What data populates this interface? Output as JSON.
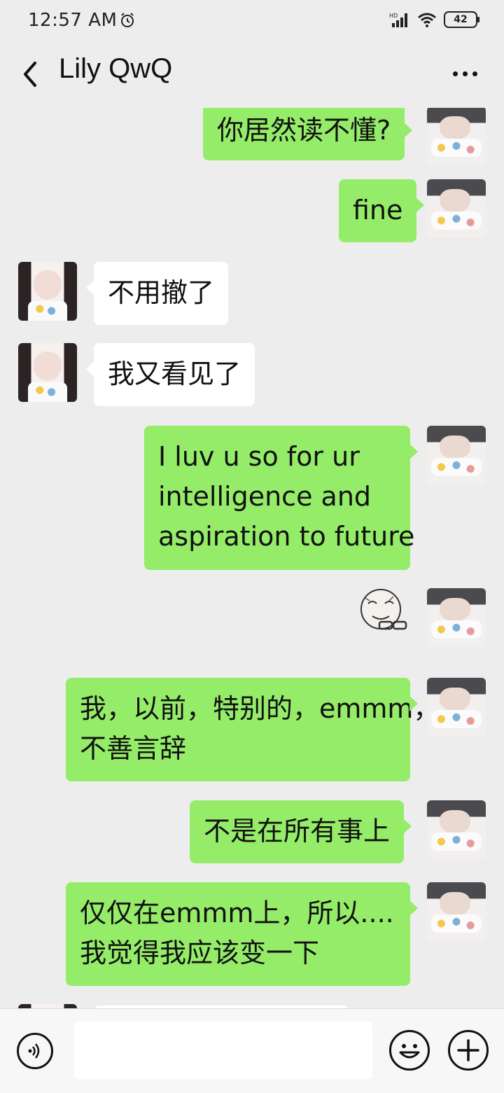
{
  "status_bar": {
    "time": "12:57 AM",
    "battery": "42",
    "network_label": "HD"
  },
  "header": {
    "title": "Lily QwQ"
  },
  "messages": [
    {
      "from": "self",
      "lines": [
        "你居然读不懂?"
      ]
    },
    {
      "from": "self",
      "lines": [
        "fine"
      ]
    },
    {
      "from": "other",
      "lines": [
        "不用撤了"
      ]
    },
    {
      "from": "other",
      "lines": [
        "我又看见了"
      ]
    },
    {
      "from": "self",
      "lines": [
        " I luv u so for ur",
        "intelligence and",
        "aspiration to future"
      ]
    },
    {
      "from": "self",
      "type": "sticker"
    },
    {
      "from": "self",
      "lines": [
        "我，以前，特别的，emmm，",
        "不善言辞"
      ]
    },
    {
      "from": "self",
      "lines": [
        "不是在所有事上"
      ]
    },
    {
      "from": "self",
      "lines": [
        "仅仅在emmm上，所以....",
        "我觉得我应该变一下"
      ]
    }
  ],
  "input": {
    "value": ""
  },
  "colors": {
    "self_bubble": "#95ec69",
    "other_bubble": "#ffffff",
    "background": "#ededed"
  }
}
